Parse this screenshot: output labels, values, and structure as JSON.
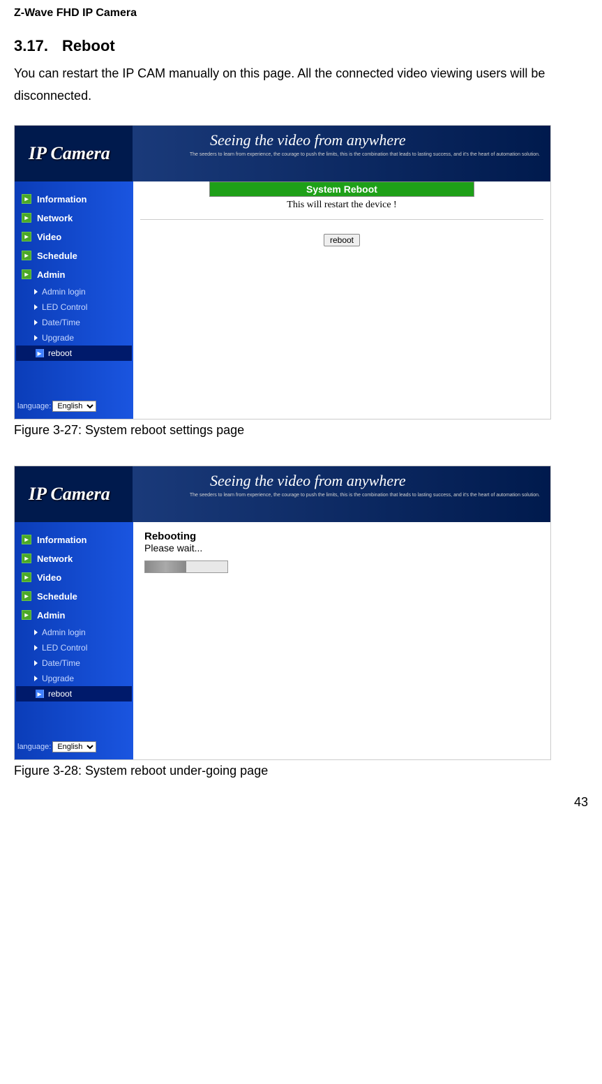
{
  "header": "Z-Wave FHD IP Camera",
  "section_num": "3.17.",
  "section_title": "Reboot",
  "intro": "You can restart the IP CAM manually on this page. All the connected video viewing users will be disconnected.",
  "figure1": {
    "caption": "Figure 3-27: System reboot settings page",
    "logo": "IP Camera",
    "tagline": "Seeing the video from anywhere",
    "subtag": "The seeders to learn from experience,\nthe courage to push the limits,\nthis is the combination that leads to lasting success,\nand it's the heart of automation solution.",
    "nav": [
      "Information",
      "Network",
      "Video",
      "Schedule",
      "Admin"
    ],
    "subnav": [
      "Admin login",
      "LED Control",
      "Date/Time",
      "Upgrade",
      "reboot"
    ],
    "lang_label": "language:",
    "lang_value": "English",
    "reboot_header": "System Reboot",
    "reboot_msg": "This will restart the device !",
    "reboot_button": "reboot"
  },
  "figure2": {
    "caption": "Figure 3-28: System reboot under-going page",
    "logo": "IP Camera",
    "tagline": "Seeing the video from anywhere",
    "subtag": "The seeders to learn from experience,\nthe courage to push the limits,\nthis is the combination that leads to lasting success,\nand it's the heart of automation solution.",
    "nav": [
      "Information",
      "Network",
      "Video",
      "Schedule",
      "Admin"
    ],
    "subnav": [
      "Admin login",
      "LED Control",
      "Date/Time",
      "Upgrade",
      "reboot"
    ],
    "lang_label": "language:",
    "lang_value": "English",
    "rebooting_title": "Rebooting",
    "rebooting_wait": "Please wait..."
  },
  "page_number": "43"
}
